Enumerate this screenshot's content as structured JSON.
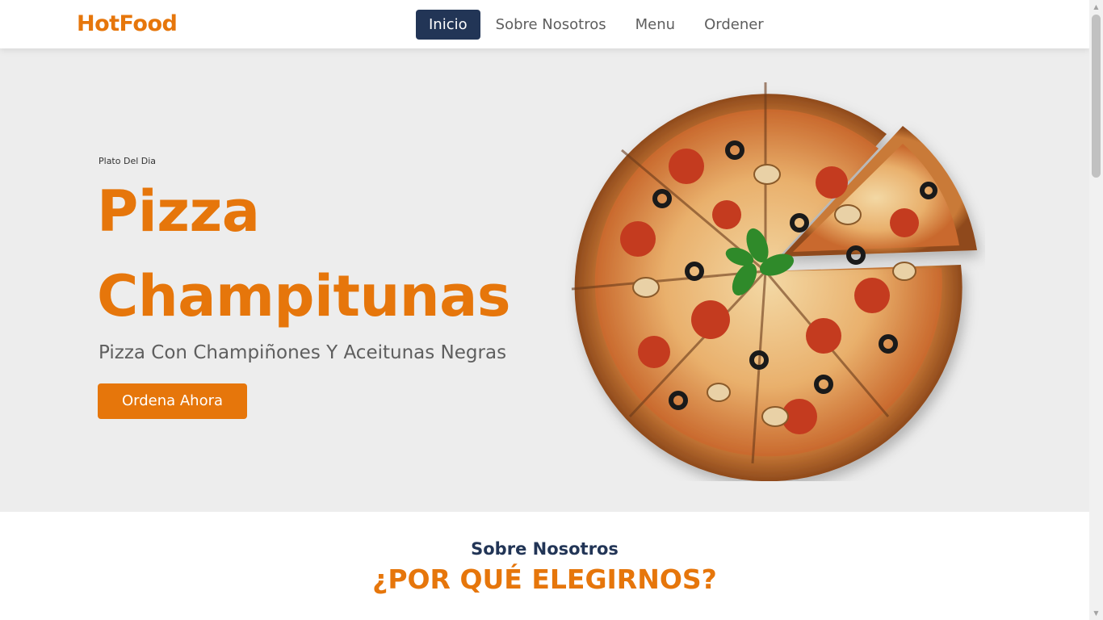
{
  "brand": {
    "name": "HotFood",
    "color": "#e6760b"
  },
  "nav": {
    "items": [
      {
        "label": "Inicio",
        "active": true
      },
      {
        "label": "Sobre Nosotros",
        "active": false
      },
      {
        "label": "Menu",
        "active": false
      },
      {
        "label": "Ordener",
        "active": false
      }
    ]
  },
  "hero": {
    "kicker": "Plato Del Dia",
    "title_line1": "Pizza",
    "title_line2": "Champitunas",
    "subtitle": "Pizza Con Champiñones Y Aceitunas Negras",
    "cta_label": "Ordena Ahora",
    "image": "pizza-image"
  },
  "about": {
    "label": "Sobre Nosotros",
    "title": "¿POR QUÉ ELEGIRNOS?"
  },
  "scrollbar": {
    "up_icon": "scroll-up-arrow-icon",
    "down_icon": "scroll-down-arrow-icon"
  },
  "colors": {
    "accent": "#e6760b",
    "navy": "#223556",
    "hero_bg": "#ededed"
  }
}
